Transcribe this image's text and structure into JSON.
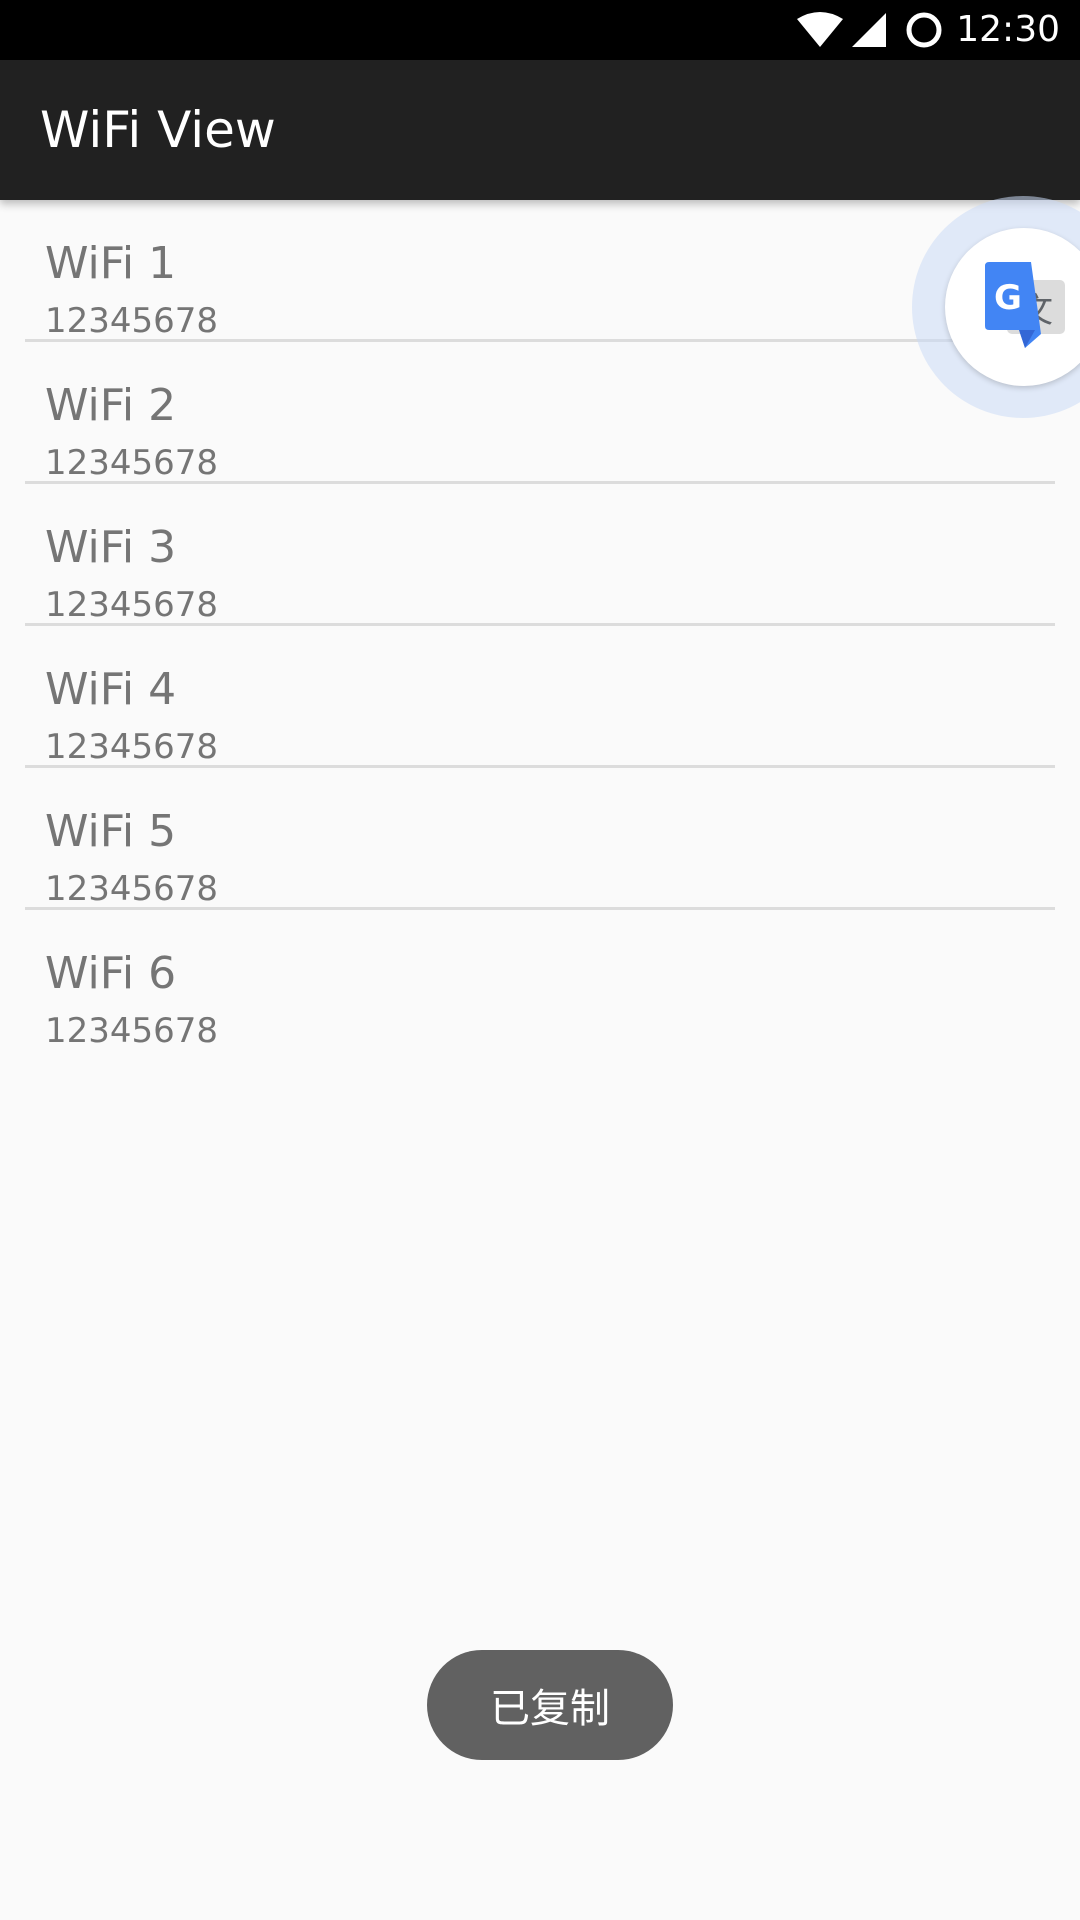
{
  "status_bar": {
    "time": "12:30",
    "icons": [
      "wifi-icon",
      "cell-signal-icon",
      "sync-circle-icon"
    ]
  },
  "app_bar": {
    "title": "WiFi View"
  },
  "wifi_list": [
    {
      "name": "WiFi 1",
      "password": "12345678"
    },
    {
      "name": "WiFi 2",
      "password": "12345678"
    },
    {
      "name": "WiFi 3",
      "password": "12345678"
    },
    {
      "name": "WiFi 4",
      "password": "12345678"
    },
    {
      "name": "WiFi 5",
      "password": "12345678"
    },
    {
      "name": "WiFi 6",
      "password": "12345678"
    }
  ],
  "floating_bubble": {
    "icon": "google-translate-icon"
  },
  "toast": {
    "message": "已复制"
  },
  "colors": {
    "status_bar_bg": "#000000",
    "app_bar_bg": "#212121",
    "page_bg": "#fafafa",
    "item_text": "#757575",
    "divider": "#dcdcdc",
    "toast_bg": "#616161",
    "translate_blue": "#4285f4"
  }
}
